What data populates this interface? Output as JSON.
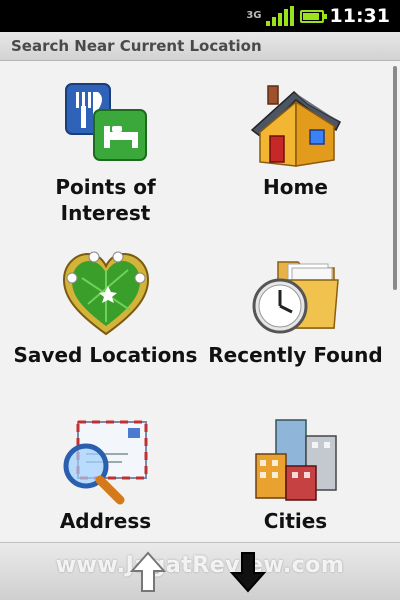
{
  "status_bar": {
    "network": "3G",
    "time": "11:31"
  },
  "title": "Search Near Current Location",
  "tiles": [
    {
      "label": "Points of Interest",
      "icon": "poi-icon"
    },
    {
      "label": "Home",
      "icon": "house-icon"
    },
    {
      "label": "Saved Locations",
      "icon": "heart-map-icon"
    },
    {
      "label": "Recently Found",
      "icon": "folder-clock-icon"
    },
    {
      "label": "Address",
      "icon": "envelope-magnifier-icon"
    },
    {
      "label": "Cities",
      "icon": "buildings-icon"
    }
  ],
  "bottom_bar": {
    "watermark": "www.JagatReview.com",
    "up_icon": "arrow-up-icon",
    "down_icon": "arrow-down-icon"
  },
  "colors": {
    "signal": "#9be21a",
    "accent_red": "#c02020",
    "map_green": "#3a9e2a"
  }
}
